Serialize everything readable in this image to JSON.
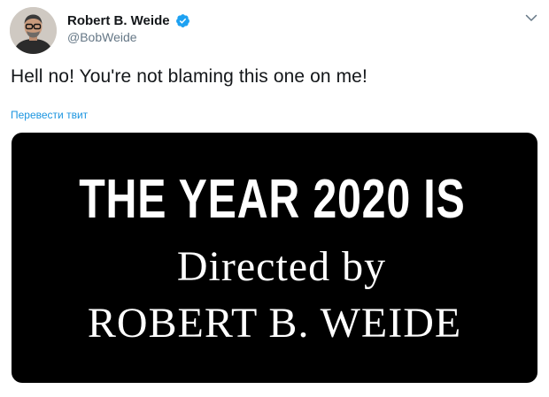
{
  "author": {
    "display_name": "Robert B. Weide",
    "handle": "@BobWeide",
    "verified": true,
    "avatar_icon": "person-portrait-avatar"
  },
  "menu": {
    "caret_icon": "chevron-down-icon"
  },
  "tweet": {
    "text": "Hell no! You're not blaming this one on me!",
    "translate_label": "Перевести твит"
  },
  "media": {
    "line1": "THE YEAR 2020 IS",
    "line2": "Directed by",
    "line3": "ROBERT B. WEIDE"
  },
  "colors": {
    "link": "#1b95e0",
    "verified": "#1da1f2",
    "secondary_text": "#657786",
    "primary_text": "#14171a",
    "media_background": "#000000"
  }
}
